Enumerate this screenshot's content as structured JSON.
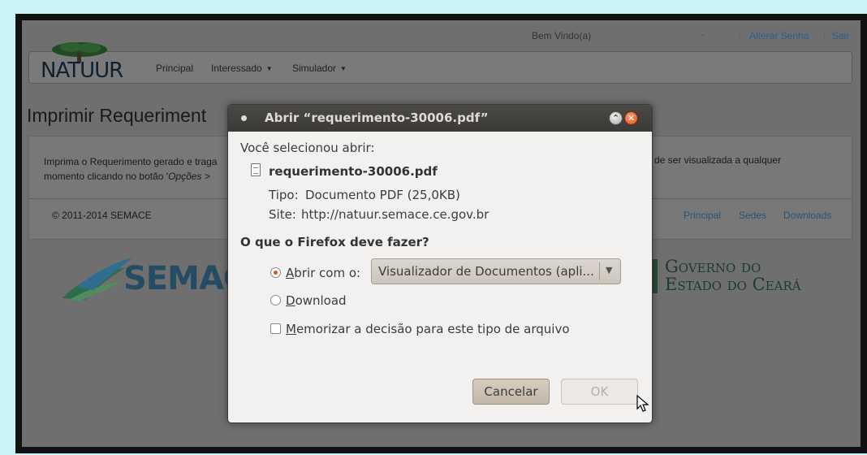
{
  "topbar": {
    "welcome": "Bem Vindo(a)",
    "dash": "-",
    "separator": "|",
    "change_password": "Alterar Senha",
    "logout": "Sair"
  },
  "navbar": {
    "logo": "NATUUR",
    "items": [
      {
        "label": "Principal",
        "dropdown": false
      },
      {
        "label": "Interessado",
        "dropdown": true
      },
      {
        "label": "Simulador",
        "dropdown": true
      }
    ],
    "caret": "▼"
  },
  "page": {
    "title": "Imprimir Requeriment",
    "content_line1": "Imprima o Requerimento gerado e traga",
    "content_line2_prefix": "momento clicando no botão '",
    "content_line2_italic": "Opções >",
    "content_right": "de ser visualizada a qualquer",
    "copyright": "© 2011-2014 SEMACE",
    "footer_links": [
      "Principal",
      "Sedes",
      "Downloads"
    ]
  },
  "logos": {
    "semace": "SEMAC",
    "governo_line1": "Governo do",
    "governo_line2": "Estado do Ceará"
  },
  "dialog": {
    "title": "Abrir “requerimento-30006.pdf”",
    "minimize_glyph": "⌃",
    "close_glyph": "✕",
    "selected_label": "Você selecionou abrir:",
    "filename": "requerimento-30006.pdf",
    "type_label": "Tipo:",
    "type_value": "Documento PDF (25,0KB)",
    "site_label": "Site:",
    "site_value": "http://natuur.semace.ce.gov.br",
    "question": "O que o Firefox deve fazer?",
    "open_with_label": "Abrir com o:",
    "open_with_value": "Visualizador de Documentos (apli...",
    "select_arrow": "▼",
    "download_label": "Download",
    "remember_label": "Memorizar a decisão para este tipo de arquivo",
    "cancel_label": "Cancelar",
    "ok_label": "OK",
    "selected_option": "open_with",
    "remember_checked": false
  },
  "colors": {
    "accent": "#e0501e",
    "titlebar": "#3b3a36",
    "link": "#2a5577"
  }
}
